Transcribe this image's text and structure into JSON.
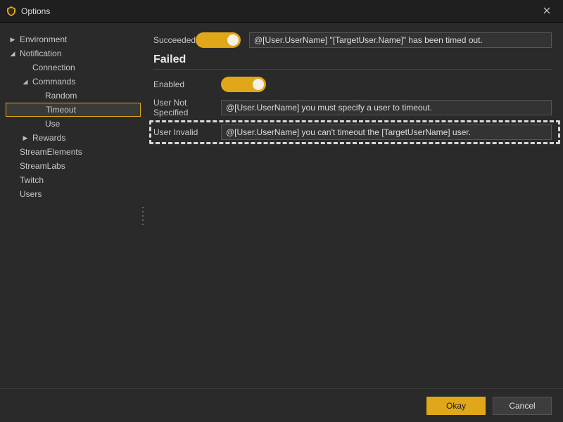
{
  "window": {
    "title": "Options"
  },
  "sidebar": {
    "items": [
      {
        "label": "Environment",
        "expander": "collapsed",
        "indent": 0
      },
      {
        "label": "Notification",
        "expander": "expanded",
        "indent": 0
      },
      {
        "label": "Connection",
        "expander": "none",
        "indent": 1
      },
      {
        "label": "Commands",
        "expander": "expanded",
        "indent": 1
      },
      {
        "label": "Random",
        "expander": "none",
        "indent": 2
      },
      {
        "label": "Timeout",
        "expander": "none",
        "indent": 2,
        "selected": true
      },
      {
        "label": "Use",
        "expander": "none",
        "indent": 2
      },
      {
        "label": "Rewards",
        "expander": "collapsed",
        "indent": 1
      },
      {
        "label": "StreamElements",
        "expander": "none",
        "indent": 0
      },
      {
        "label": "StreamLabs",
        "expander": "none",
        "indent": 0
      },
      {
        "label": "Twitch",
        "expander": "none",
        "indent": 0
      },
      {
        "label": "Users",
        "expander": "none",
        "indent": 0
      }
    ]
  },
  "content": {
    "succeeded_label": "Succeeded",
    "succeeded_value": "@[User.UserName] \"[TargetUser.Name]\" has been timed out.",
    "failed_title": "Failed",
    "enabled_label": "Enabled",
    "user_not_specified_label": "User Not Specified",
    "user_not_specified_value": "@[User.UserName] you must specify a user to timeout.",
    "user_invalid_label": "User Invalid",
    "user_invalid_value": "@[User.UserName] you can't timeout the [TargetUserName] user."
  },
  "footer": {
    "okay_label": "Okay",
    "cancel_label": "Cancel"
  }
}
